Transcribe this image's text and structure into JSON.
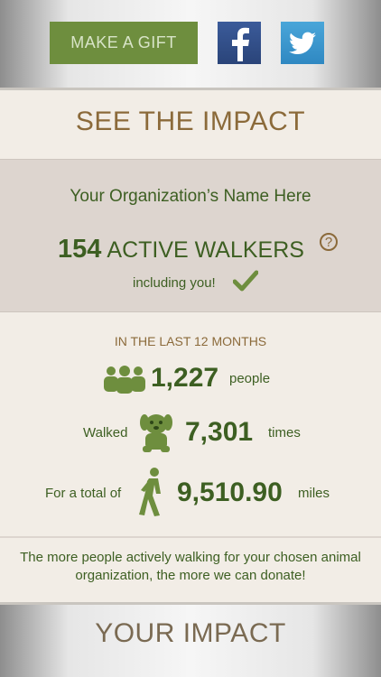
{
  "header": {
    "gift_button": "MAKE A GIFT",
    "facebook_icon": "facebook-icon",
    "twitter_icon": "twitter-icon"
  },
  "impact": {
    "title": "SEE THE IMPACT",
    "org_name": "Your Organization’s Name Here",
    "active_walkers_count": "154",
    "active_walkers_label": "ACTIVE WALKERS",
    "including_you": "including you!"
  },
  "stats": {
    "period_label": "IN THE LAST 12 MONTHS",
    "people_count": "1,227",
    "people_label": "people",
    "walked_prefix": "Walked",
    "walked_count": "7,301",
    "walked_suffix": "times",
    "total_prefix": "For a total of",
    "miles_count": "9,510.90",
    "miles_suffix": "miles"
  },
  "footer": {
    "message": "The more people actively walking for your chosen animal organization, the more we can donate!",
    "your_impact": "YOUR IMPACT"
  },
  "colors": {
    "accent_green": "#3d5f22",
    "button_green": "#6e8e3e",
    "brown": "#8b6a3a",
    "panel": "#ddd5cf",
    "background": "#f2ede6"
  }
}
